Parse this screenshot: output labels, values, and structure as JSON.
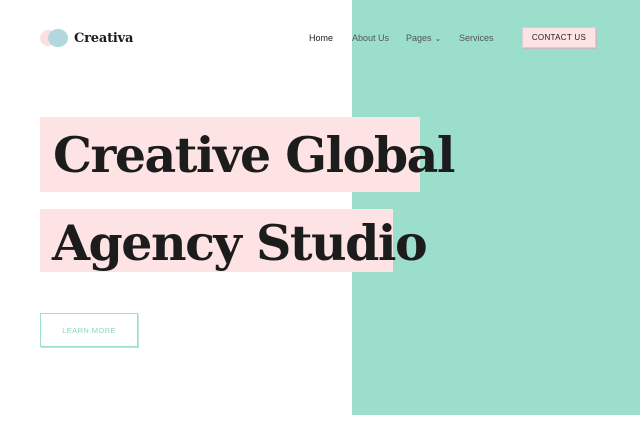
{
  "colors": {
    "teal": "#9bdecb",
    "pink": "#fde3e3",
    "logo_circle_pink": "#f9dcdc",
    "logo_circle_blue": "#b1d8de",
    "text_dark": "#1c1c1c"
  },
  "header": {
    "logo_text": "Creativa",
    "nav": {
      "home": "Home",
      "about": "About Us",
      "pages": "Pages",
      "pages_icon": "chevron-down-icon",
      "services": "Services"
    },
    "contact_label": "CONTACT US"
  },
  "hero": {
    "line1": "Creative Global",
    "line2": "Agency Studio",
    "cta_label": "LEARN MORE"
  }
}
